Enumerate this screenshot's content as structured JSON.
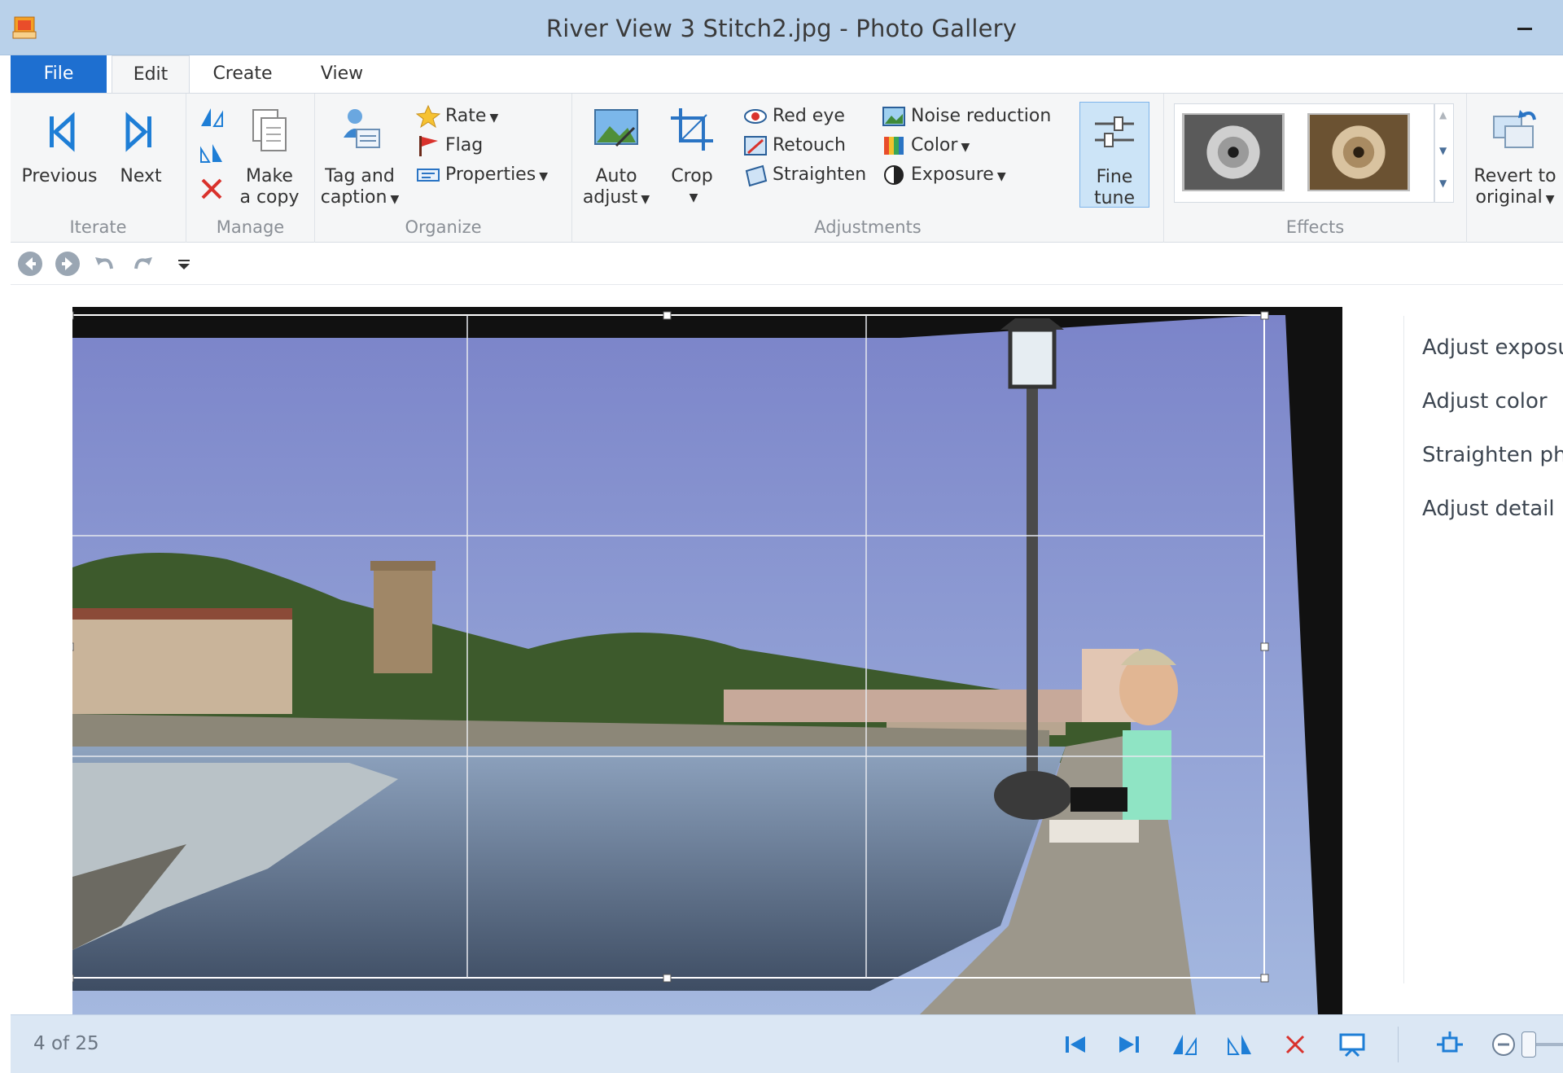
{
  "window": {
    "title": "River View 3 Stitch2.jpg - Photo Gallery"
  },
  "tabs": [
    {
      "label": "File"
    },
    {
      "label": "Edit"
    },
    {
      "label": "Create"
    },
    {
      "label": "View"
    }
  ],
  "ribbon": {
    "iterate": {
      "label": "Iterate",
      "previous": "Previous",
      "next": "Next"
    },
    "manage": {
      "label": "Manage",
      "make_copy_line1": "Make",
      "make_copy_line2": "a copy"
    },
    "organize": {
      "label": "Organize",
      "tag_line1": "Tag and",
      "tag_line2": "caption",
      "rate": "Rate",
      "flag": "Flag",
      "properties": "Properties"
    },
    "adjustments": {
      "label": "Adjustments",
      "auto_line1": "Auto",
      "auto_line2": "adjust",
      "crop": "Crop",
      "red_eye": "Red eye",
      "retouch": "Retouch",
      "straighten": "Straighten",
      "noise_reduction": "Noise reduction",
      "color": "Color",
      "exposure": "Exposure",
      "fine_line1": "Fine",
      "fine_line2": "tune"
    },
    "effects": {
      "label": "Effects"
    },
    "revert": {
      "line1": "Revert to",
      "line2": "original"
    }
  },
  "side_panel": {
    "items": [
      {
        "label": "Adjust exposu"
      },
      {
        "label": "Adjust color"
      },
      {
        "label": "Straighten pho"
      },
      {
        "label": "Adjust detail"
      }
    ]
  },
  "status": {
    "count": "4 of 25"
  },
  "colors": {
    "file_tab": "#1e6fd0",
    "title_bar": "#b9d1ea",
    "icon_blue": "#1e7ed6",
    "delete_red": "#d9322c",
    "fine_tune_selected": "#cce4f7"
  }
}
